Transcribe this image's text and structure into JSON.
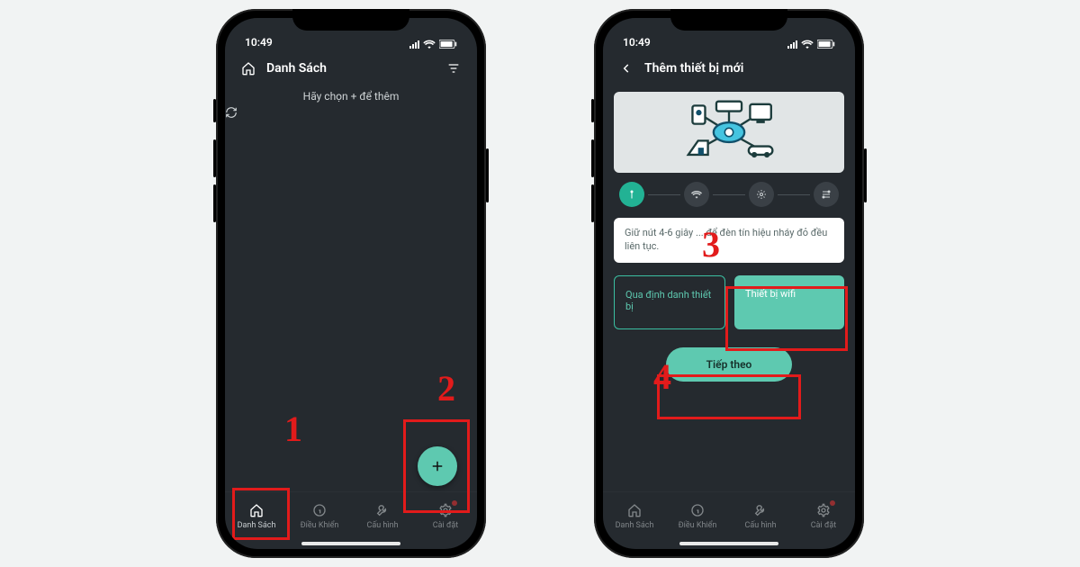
{
  "status": {
    "time": "10:49"
  },
  "screen1": {
    "title": "Danh Sách",
    "empty_hint": "Hãy chọn + để thêm"
  },
  "screen2": {
    "title": "Thêm thiết bị mới",
    "info_card": "Giữ nút 4-6 giây ... để đèn tín hiệu nháy đỏ đều liên tục.",
    "choice_outline": "Qua định danh thiết bị",
    "choice_solid": "Thiết bị wifi",
    "next_label": "Tiếp theo"
  },
  "tabs": {
    "t1": "Danh Sách",
    "t2": "Điều Khiển",
    "t3": "Cấu hình",
    "t4": "Cài đặt"
  },
  "annotations": {
    "n1": "1",
    "n2": "2",
    "n3": "3",
    "n4": "4"
  },
  "colors": {
    "accent": "#5ec9b0",
    "annotation": "#e21b1b"
  }
}
